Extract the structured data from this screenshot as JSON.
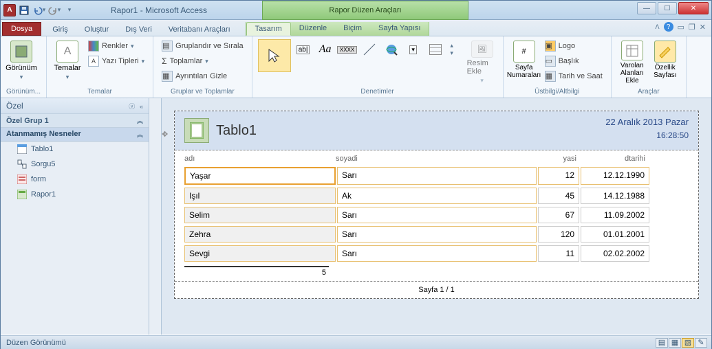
{
  "titlebar": {
    "title": "Rapor1  -  Microsoft Access",
    "contextual": "Rapor Düzen Araçları"
  },
  "tabs": {
    "file": "Dosya",
    "home": "Giriş",
    "create": "Oluştur",
    "external": "Dış Veri",
    "dbtools": "Veritabanı Araçları",
    "design": "Tasarım",
    "arrange": "Düzenle",
    "format": "Biçim",
    "page": "Sayfa Yapısı"
  },
  "groups": {
    "views": "Görünüm...",
    "themes": "Temalar",
    "grouping": "Gruplar ve Toplamlar",
    "controls": "Denetimler",
    "header": "Üstbilgi/Altbilgi",
    "tools": "Araçlar"
  },
  "buttons": {
    "view": "Görünüm",
    "themes": "Temalar",
    "colors": "Renkler",
    "fonts": "Yazı Tipleri",
    "group_sort": "Gruplandır ve Sırala",
    "totals": "Toplamlar",
    "hide_details": "Ayrıntıları Gizle",
    "image": "Resim Ekle",
    "page_numbers": "Sayfa Numaraları",
    "logo": "Logo",
    "title": "Başlık",
    "date_time": "Tarih ve Saat",
    "existing": "Varolan Alanları Ekle",
    "property": "Özellik Sayfası"
  },
  "nav": {
    "header": "Özel",
    "group": "Özel Grup 1",
    "unassigned": "Atanmamış Nesneler",
    "items": [
      "Tablo1",
      "Sorgu5",
      "form",
      "Rapor1"
    ]
  },
  "report": {
    "title": "Tablo1",
    "date": "22 Aralık 2013 Pazar",
    "time": "16:28:50",
    "columns": {
      "c1": "adı",
      "c2": "soyadi",
      "c3": "yasi",
      "c4": "dtarihi"
    },
    "rows": [
      {
        "c1": "Yaşar",
        "c2": "Sarı",
        "c3": "12",
        "c4": "12.12.1990"
      },
      {
        "c1": "Işıl",
        "c2": "Ak",
        "c3": "45",
        "c4": "14.12.1988"
      },
      {
        "c1": "Selim",
        "c2": "Sarı",
        "c3": "67",
        "c4": "11.09.2002"
      },
      {
        "c1": "Zehra",
        "c2": "Sarı",
        "c3": "120",
        "c4": "01.01.2001"
      },
      {
        "c1": "Sevgi",
        "c2": "Sarı",
        "c3": "11",
        "c4": "02.02.2002"
      }
    ],
    "count": "5",
    "pager": "Sayfa 1 / 1"
  },
  "status": {
    "text": "Düzen Görünümü"
  }
}
